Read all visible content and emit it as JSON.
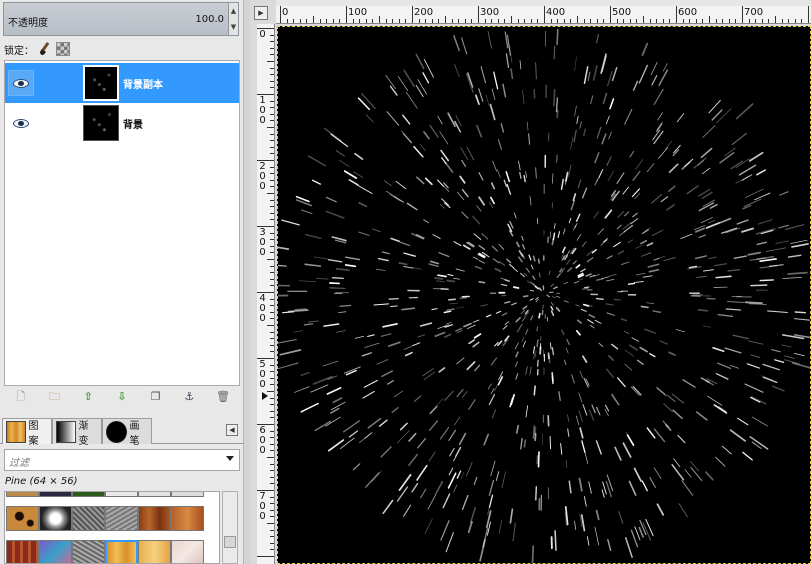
{
  "layers_panel": {
    "opacity": {
      "label": "不透明度",
      "value": "100.0"
    },
    "lock": {
      "label": "锁定："
    },
    "layers": [
      {
        "name": "背景副本",
        "selected": true,
        "visible": true
      },
      {
        "name": "背景",
        "selected": false,
        "visible": true
      }
    ],
    "tool_icons": [
      "new-layer-icon",
      "folder-icon",
      "raise-icon",
      "lower-icon",
      "duplicate-icon",
      "anchor-icon",
      "trash-icon"
    ]
  },
  "resource_tabs": [
    {
      "label": "图案",
      "icon": "pattern-swatch",
      "active": true
    },
    {
      "label": "渐变",
      "icon": "gradient-swatch",
      "active": false
    },
    {
      "label": "画笔",
      "icon": "brush-swatch",
      "active": false
    }
  ],
  "patterns": {
    "filter_placeholder": "过滤",
    "selected_name": "Pine (64 × 56)"
  },
  "ruler": {
    "h_labels": [
      "0",
      "100",
      "200",
      "300",
      "400",
      "500",
      "600",
      "700"
    ],
    "v_labels": [
      "0",
      "100",
      "200",
      "300",
      "400",
      "500",
      "600",
      "700"
    ]
  },
  "colors": {
    "selection": "#3399ff",
    "canvas_background": "#000000",
    "star": "#ffffff"
  }
}
